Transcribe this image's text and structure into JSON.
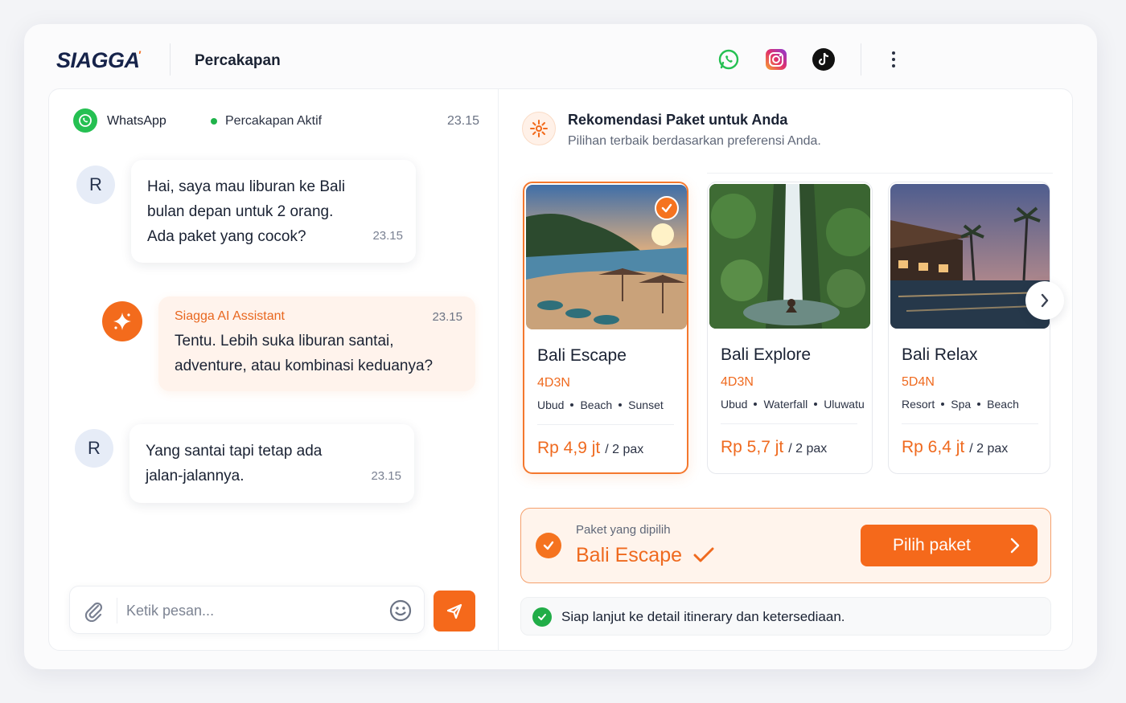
{
  "header": {
    "logo": "SIAGGA",
    "title": "Percakapan",
    "channels": [
      "whatsapp-icon",
      "instagram-icon",
      "tiktok-icon"
    ]
  },
  "chat": {
    "channel": "WhatsApp",
    "status": "Percakapan Aktif",
    "time": "23.15",
    "messages": [
      {
        "from": "user",
        "avatar": "R",
        "lines": [
          "Hai, saya mau liburan ke Bali",
          "bulan depan untuk 2 orang.",
          "Ada paket yang cocok?"
        ],
        "time": "23.15"
      },
      {
        "from": "assistant",
        "name": "Siagga AI Assistant",
        "lines": [
          "Tentu. Lebih suka liburan santai,",
          "adventure, atau kombinasi keduanya?"
        ],
        "time": "23.15"
      },
      {
        "from": "user",
        "avatar": "R",
        "lines": [
          "Yang santai tapi tetap ada",
          "jalan-jalannya."
        ],
        "time": "23.15"
      }
    ],
    "composer": {
      "placeholder": "Ketik pesan..."
    }
  },
  "recommendations": {
    "title": "Rekomendasi Paket untuk Anda",
    "subtitle": "Pilihan terbaik berdasarkan preferensi Anda.",
    "packages": [
      {
        "name": "Bali Escape",
        "duration": "4D3N",
        "tags": [
          "Ubud",
          "Beach",
          "Sunset"
        ],
        "price": "Rp 4,9 jt",
        "per": "/ 2 pax",
        "selected": true
      },
      {
        "name": "Bali Explore",
        "duration": "4D3N",
        "tags": [
          "Ubud",
          "Waterfall",
          "Uluwatu"
        ],
        "price": "Rp 5,7 jt",
        "per": "/ 2 pax",
        "selected": false
      },
      {
        "name": "Bali Relax",
        "duration": "5D4N",
        "tags": [
          "Resort",
          "Spa",
          "Beach"
        ],
        "price": "Rp 6,4 jt",
        "per": "/ 2 pax",
        "selected": false
      }
    ],
    "selection": {
      "label": "Paket yang dipilih",
      "value": "Bali Escape",
      "button": "Pilih paket"
    },
    "ready_text": "Siap lanjut ke detail itinerary dan ketersediaan."
  },
  "colors": {
    "accent": "#f5691b",
    "whatsapp": "#25c052"
  }
}
